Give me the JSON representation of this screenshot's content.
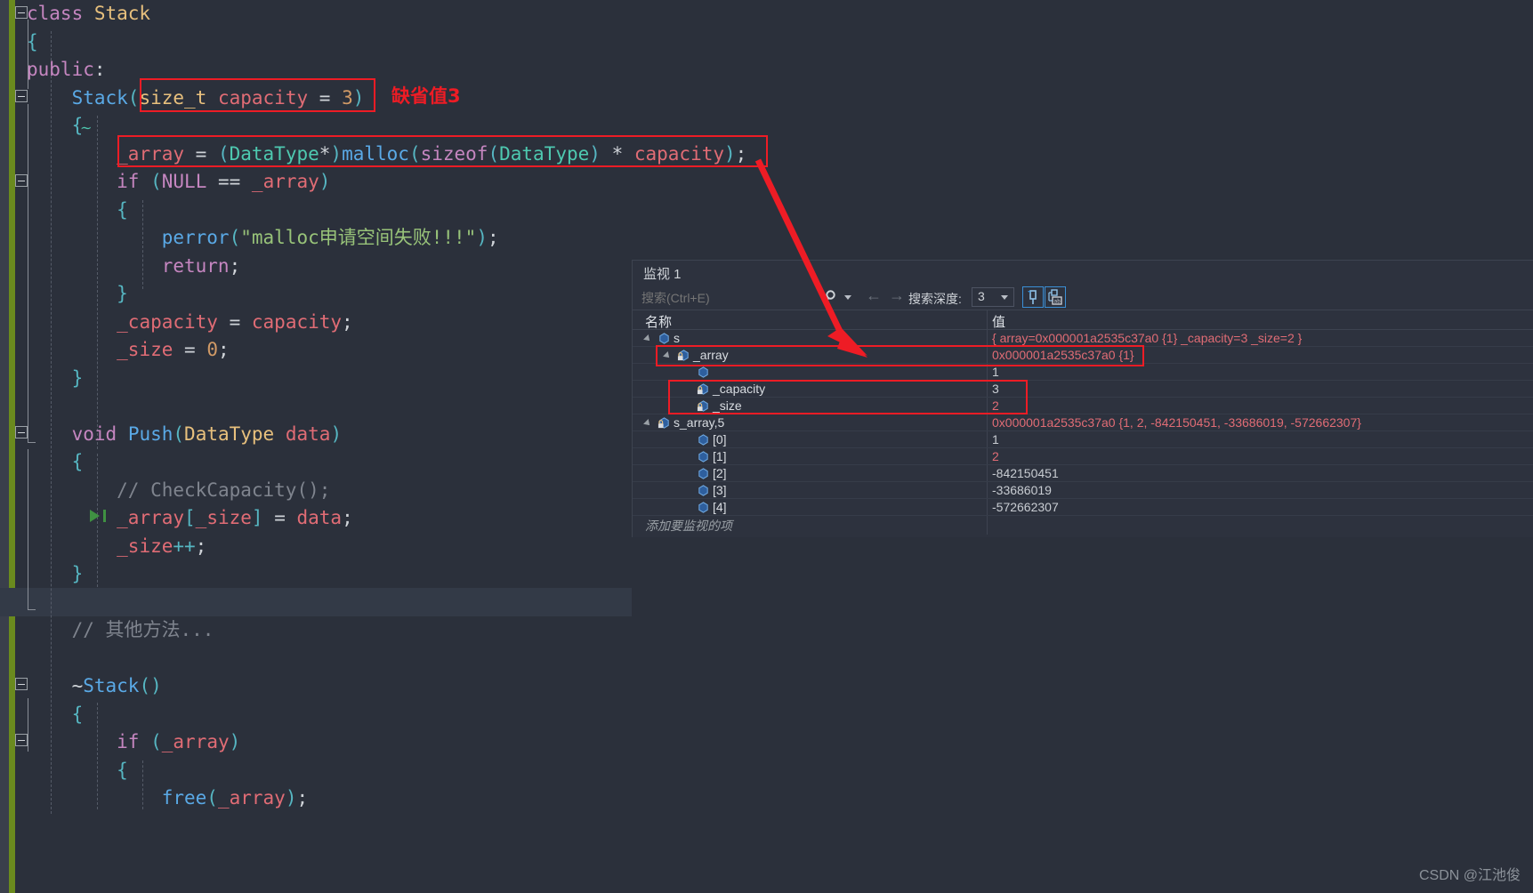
{
  "editor": {
    "language": "cpp",
    "lines": [
      {
        "indent": 0,
        "tokens": [
          {
            "t": "class ",
            "c": "kw"
          },
          {
            "t": "Stack",
            "c": "tname"
          }
        ]
      },
      {
        "indent": 0,
        "tokens": [
          {
            "t": "{",
            "c": "punc"
          }
        ]
      },
      {
        "indent": 0,
        "tokens": [
          {
            "t": "public",
            "c": "kw"
          },
          {
            "t": ":",
            "c": "white"
          }
        ]
      },
      {
        "indent": 1,
        "tokens": [
          {
            "t": "Stack",
            "c": "fn"
          },
          {
            "t": "(",
            "c": "punc"
          },
          {
            "t": "size_t",
            "c": "tname"
          },
          {
            "t": " ",
            "c": "white"
          },
          {
            "t": "capacity",
            "c": "var"
          },
          {
            "t": " = ",
            "c": "white"
          },
          {
            "t": "3",
            "c": "num"
          },
          {
            "t": ")",
            "c": "punc"
          }
        ]
      },
      {
        "indent": 1,
        "tokens": [
          {
            "t": "{",
            "c": "punc"
          }
        ]
      },
      {
        "indent": 2,
        "tokens": [
          {
            "t": "_array",
            "c": "var"
          },
          {
            "t": " = ",
            "c": "white"
          },
          {
            "t": "(",
            "c": "punc"
          },
          {
            "t": "DataType",
            "c": "typ"
          },
          {
            "t": "*",
            "c": "white"
          },
          {
            "t": ")",
            "c": "punc"
          },
          {
            "t": "malloc",
            "c": "fn"
          },
          {
            "t": "(",
            "c": "punc"
          },
          {
            "t": "sizeof",
            "c": "kw"
          },
          {
            "t": "(",
            "c": "punc"
          },
          {
            "t": "DataType",
            "c": "typ"
          },
          {
            "t": ")",
            "c": "punc"
          },
          {
            "t": " * ",
            "c": "white"
          },
          {
            "t": "capacity",
            "c": "var"
          },
          {
            "t": ")",
            "c": "punc"
          },
          {
            "t": ";",
            "c": "white"
          }
        ]
      },
      {
        "indent": 2,
        "tokens": [
          {
            "t": "if",
            "c": "kw"
          },
          {
            "t": " ",
            "c": "white"
          },
          {
            "t": "(",
            "c": "punc"
          },
          {
            "t": "NULL",
            "c": "cls"
          },
          {
            "t": " == ",
            "c": "white"
          },
          {
            "t": "_array",
            "c": "var"
          },
          {
            "t": ")",
            "c": "punc"
          }
        ]
      },
      {
        "indent": 2,
        "tokens": [
          {
            "t": "{",
            "c": "punc"
          }
        ]
      },
      {
        "indent": 3,
        "tokens": [
          {
            "t": "perror",
            "c": "fn"
          },
          {
            "t": "(",
            "c": "punc"
          },
          {
            "t": "\"malloc申请空间失败!!!\"",
            "c": "str"
          },
          {
            "t": ")",
            "c": "punc"
          },
          {
            "t": ";",
            "c": "white"
          }
        ]
      },
      {
        "indent": 3,
        "tokens": [
          {
            "t": "return",
            "c": "kw"
          },
          {
            "t": ";",
            "c": "white"
          }
        ]
      },
      {
        "indent": 2,
        "tokens": [
          {
            "t": "}",
            "c": "punc"
          }
        ]
      },
      {
        "indent": 2,
        "tokens": [
          {
            "t": "_capacity",
            "c": "var"
          },
          {
            "t": " = ",
            "c": "white"
          },
          {
            "t": "capacity",
            "c": "var"
          },
          {
            "t": ";",
            "c": "white"
          }
        ]
      },
      {
        "indent": 2,
        "tokens": [
          {
            "t": "_size",
            "c": "var"
          },
          {
            "t": " = ",
            "c": "white"
          },
          {
            "t": "0",
            "c": "num"
          },
          {
            "t": ";",
            "c": "white"
          }
        ]
      },
      {
        "indent": 1,
        "tokens": [
          {
            "t": "}",
            "c": "punc"
          }
        ]
      },
      {
        "indent": 0,
        "tokens": []
      },
      {
        "indent": 1,
        "tokens": [
          {
            "t": "void",
            "c": "kw"
          },
          {
            "t": " ",
            "c": "white"
          },
          {
            "t": "Push",
            "c": "fn"
          },
          {
            "t": "(",
            "c": "punc"
          },
          {
            "t": "DataType",
            "c": "tname"
          },
          {
            "t": " ",
            "c": "white"
          },
          {
            "t": "data",
            "c": "var"
          },
          {
            "t": ")",
            "c": "punc"
          }
        ]
      },
      {
        "indent": 1,
        "tokens": [
          {
            "t": "{",
            "c": "punc"
          }
        ]
      },
      {
        "indent": 2,
        "tokens": [
          {
            "t": "// CheckCapacity();",
            "c": "cmt"
          }
        ]
      },
      {
        "indent": 2,
        "tokens": [
          {
            "t": "_array",
            "c": "var"
          },
          {
            "t": "[",
            "c": "punc"
          },
          {
            "t": "_size",
            "c": "var"
          },
          {
            "t": "]",
            "c": "punc"
          },
          {
            "t": " = ",
            "c": "white"
          },
          {
            "t": "data",
            "c": "var"
          },
          {
            "t": ";",
            "c": "white"
          }
        ]
      },
      {
        "indent": 2,
        "tokens": [
          {
            "t": "_size",
            "c": "var"
          },
          {
            "t": "++",
            "c": "punc"
          },
          {
            "t": ";",
            "c": "white"
          }
        ]
      },
      {
        "indent": 1,
        "tokens": [
          {
            "t": "}",
            "c": "punc"
          }
        ]
      },
      {
        "indent": 0,
        "tokens": []
      },
      {
        "indent": 1,
        "tokens": [
          {
            "t": "// 其他方法...",
            "c": "cmt"
          }
        ]
      },
      {
        "indent": 0,
        "tokens": []
      },
      {
        "indent": 1,
        "tokens": [
          {
            "t": "~",
            "c": "white"
          },
          {
            "t": "Stack",
            "c": "fn"
          },
          {
            "t": "()",
            "c": "punc"
          }
        ]
      },
      {
        "indent": 1,
        "tokens": [
          {
            "t": "{",
            "c": "punc"
          }
        ]
      },
      {
        "indent": 2,
        "tokens": [
          {
            "t": "if",
            "c": "kw"
          },
          {
            "t": " ",
            "c": "white"
          },
          {
            "t": "(",
            "c": "punc"
          },
          {
            "t": "_array",
            "c": "var"
          },
          {
            "t": ")",
            "c": "punc"
          }
        ]
      },
      {
        "indent": 2,
        "tokens": [
          {
            "t": "{",
            "c": "punc"
          }
        ]
      },
      {
        "indent": 3,
        "tokens": [
          {
            "t": "free",
            "c": "fn"
          },
          {
            "t": "(",
            "c": "punc"
          },
          {
            "t": "_array",
            "c": "var"
          },
          {
            "t": ")",
            "c": "punc"
          },
          {
            "t": ";",
            "c": "white"
          }
        ]
      }
    ]
  },
  "annotations": {
    "label_default_value": "缺省值3",
    "accent_color": "#ee1c25"
  },
  "watch": {
    "title": "监视 1",
    "search_placeholder": "搜索(Ctrl+E)",
    "search_value": "",
    "search_icon": "magnifier-icon",
    "prev_icon": "arrow-left-icon",
    "next_icon": "arrow-right-icon",
    "depth_label": "搜索深度:",
    "depth_value": "3",
    "button_pin": "pin-icon",
    "button_hex": "hex-display-icon",
    "columns": [
      "名称",
      "值"
    ],
    "add_item_placeholder": "添加要监视的项",
    "rows": [
      {
        "name": "s",
        "value": "{ array=0x000001a2535c37a0 {1} _capacity=3 _size=2 }",
        "depth": 0,
        "expander": "expanded",
        "icon": "cube-icon",
        "locked": false,
        "value_color": "red"
      },
      {
        "name": "_array",
        "value": "0x000001a2535c37a0 {1}",
        "depth": 1,
        "expander": "expanded",
        "icon": "cube-icon",
        "locked": true,
        "value_color": "red"
      },
      {
        "name": "",
        "value": "1",
        "depth": 2,
        "expander": "none",
        "icon": "cube-icon",
        "locked": false,
        "value_color": "norm"
      },
      {
        "name": "_capacity",
        "value": "3",
        "depth": 2,
        "expander": "none",
        "icon": "cube-icon",
        "locked": true,
        "value_color": "norm"
      },
      {
        "name": "_size",
        "value": "2",
        "depth": 2,
        "expander": "none",
        "icon": "cube-icon",
        "locked": true,
        "value_color": "red"
      },
      {
        "name": "s_array,5",
        "value": "0x000001a2535c37a0 {1, 2, -842150451, -33686019, -572662307}",
        "depth": 0,
        "expander": "expanded",
        "icon": "cube-icon",
        "locked": true,
        "value_color": "red"
      },
      {
        "name": "[0]",
        "value": "1",
        "depth": 2,
        "expander": "none",
        "icon": "cube-icon",
        "locked": false,
        "value_color": "norm"
      },
      {
        "name": "[1]",
        "value": "2",
        "depth": 2,
        "expander": "none",
        "icon": "cube-icon",
        "locked": false,
        "value_color": "red"
      },
      {
        "name": "[2]",
        "value": "-842150451",
        "depth": 2,
        "expander": "none",
        "icon": "cube-icon",
        "locked": false,
        "value_color": "norm"
      },
      {
        "name": "[3]",
        "value": "-33686019",
        "depth": 2,
        "expander": "none",
        "icon": "cube-icon",
        "locked": false,
        "value_color": "norm"
      },
      {
        "name": "[4]",
        "value": "-572662307",
        "depth": 2,
        "expander": "none",
        "icon": "cube-icon",
        "locked": false,
        "value_color": "norm"
      }
    ]
  },
  "watermark": "CSDN @江池俊"
}
